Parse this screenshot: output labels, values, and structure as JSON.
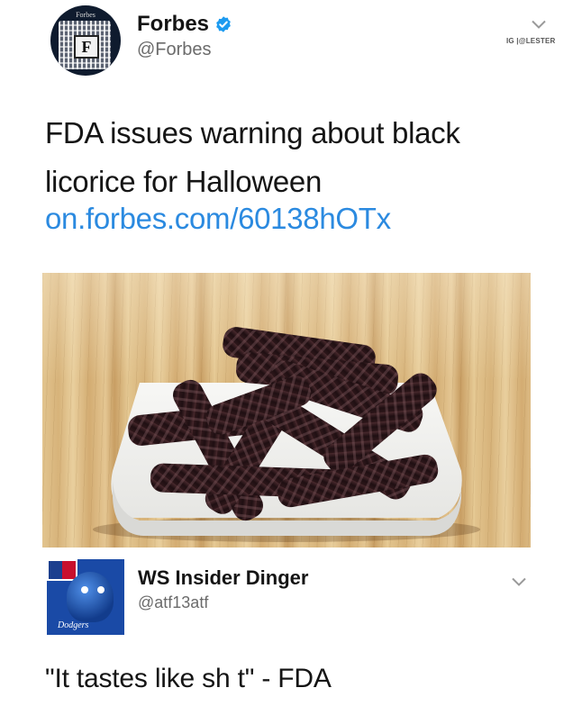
{
  "tweet": {
    "avatar_label": "Forbes",
    "avatar_letter": "F",
    "display_name": "Forbes",
    "handle": "@Forbes",
    "watermark": "IG |@LESTER",
    "text": "FDA issues warning about black licorice for Halloween",
    "link": "on.forbes.com/60138hOTx",
    "colors": {
      "link": "#2b8ae0",
      "verified": "#1d9bf0"
    }
  },
  "reply": {
    "display_name": "WS Insider Dinger",
    "handle": "@atf13atf",
    "avatar_label": "Dodgers",
    "text": "\"It tastes like sh t\" - FDA"
  }
}
